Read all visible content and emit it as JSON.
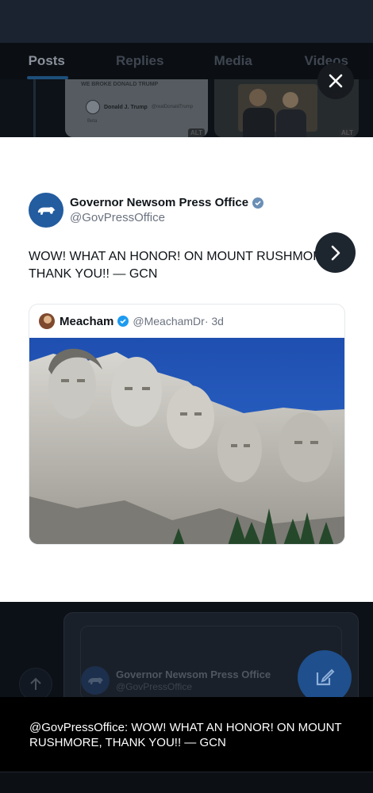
{
  "background": {
    "tabs": [
      {
        "label": "Posts",
        "active": true
      },
      {
        "label": "Replies",
        "active": false
      },
      {
        "label": "Media",
        "active": false
      },
      {
        "label": "Videos",
        "active": false
      }
    ],
    "card_a": {
      "headline": "WE BROKE DONALD TRUMP",
      "name": "Donald J. Trump",
      "handle": "@realDonaldTrump",
      "body": "Beta",
      "alt": "ALT"
    },
    "card_b": {
      "alt": "ALT"
    },
    "lower_card": {
      "name": "Governor Newsom Press Office",
      "handle": "@GovPressOffice"
    }
  },
  "viewer": {
    "close_icon": "close-icon",
    "next_icon": "chevron-right-icon"
  },
  "post": {
    "author_name": "Governor Newsom Press Office",
    "author_handle": "@GovPressOffice",
    "verified": true,
    "text": "WOW! WHAT AN HONOR! ON MOUNT RUSHMORE, THANK YOU!! — GCN",
    "quote": {
      "name": "Meacham",
      "handle": "@MeachamDr",
      "time": "· 3d",
      "verified": true
    }
  },
  "caption": "@GovPressOffice: WOW! WHAT AN HONOR! ON MOUNT RUSHMORE, THANK YOU!! — GCN",
  "colors": {
    "accent": "#1d9bf0",
    "panel": "#ffffff",
    "avatar": "#235c9f",
    "fab": "#1f4f8d"
  }
}
